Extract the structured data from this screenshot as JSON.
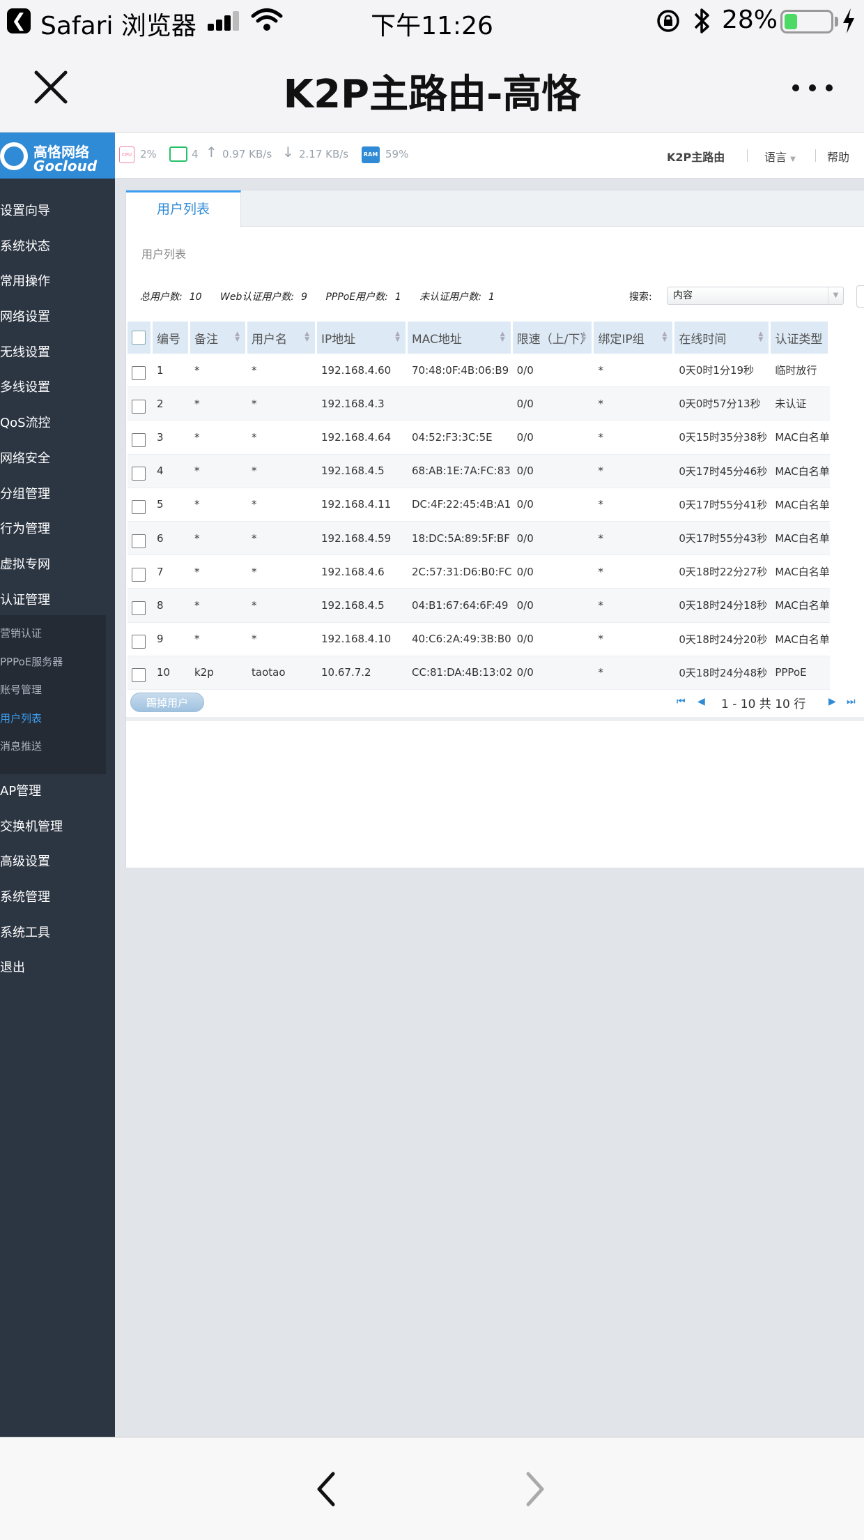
{
  "status_bar": {
    "app_name": "Safari 浏览器",
    "time": "下午11:26",
    "battery_percent": "28%",
    "battery_level": 0.28,
    "icons": [
      "back-app-icon",
      "signal-icon",
      "wifi-icon",
      "orientation-lock-icon",
      "bluetooth-icon",
      "battery-icon",
      "charging-icon"
    ]
  },
  "nav_bar": {
    "title": "K2P主路由-高恪",
    "icons": [
      "close-icon",
      "more-icon"
    ]
  },
  "router": {
    "logo": {
      "cn": "高恪网络",
      "en": "Gocloud"
    },
    "topbar": {
      "cpu_label": "CPU",
      "cpu": "2%",
      "clients": "4",
      "upload": "0.97 KB/s",
      "download": "2.17 KB/s",
      "ram_label": "RAM",
      "ram": "59%",
      "device_name": "K2P主路由",
      "language": "语言",
      "help": "帮助"
    },
    "sidebar": {
      "items_top": [
        "设置向导",
        "系统状态",
        "常用操作",
        "网络设置",
        "无线设置",
        "多线设置",
        "QoS流控",
        "网络安全",
        "分组管理",
        "行为管理",
        "虚拟专网",
        "认证管理"
      ],
      "sub_items": [
        "营销认证",
        "PPPoE服务器",
        "账号管理",
        "用户列表",
        "消息推送"
      ],
      "active_sub": "用户列表",
      "items_bottom": [
        "AP管理",
        "交换机管理",
        "高级设置",
        "系统管理",
        "系统工具",
        "退出"
      ]
    },
    "tab": "用户列表",
    "section_title": "用户列表",
    "stats": {
      "total_label": "总用户数:",
      "total": "10",
      "web_label": "Web认证用户数:",
      "web": "9",
      "pppoe_label": "PPPoE用户数:",
      "pppoe": "1",
      "unauth_label": "未认证用户数:",
      "unauth": "1"
    },
    "search": {
      "label": "搜索:",
      "selected": "内容"
    },
    "table": {
      "columns": [
        "编号",
        "备注",
        "用户名",
        "IP地址",
        "MAC地址",
        "限速（上/下）",
        "绑定IP组",
        "在线时间",
        "认证类型"
      ],
      "rows": [
        [
          "1",
          "*",
          "*",
          "192.168.4.60",
          "70:48:0F:4B:06:B9",
          "0/0",
          "*",
          "0天0时1分19秒",
          "临时放行"
        ],
        [
          "2",
          "*",
          "*",
          "192.168.4.3",
          "",
          "0/0",
          "*",
          "0天0时57分13秒",
          "未认证"
        ],
        [
          "3",
          "*",
          "*",
          "192.168.4.64",
          "04:52:F3:3C:5E",
          "0/0",
          "*",
          "0天15时35分38秒",
          "MAC白名单"
        ],
        [
          "4",
          "*",
          "*",
          "192.168.4.5",
          "68:AB:1E:7A:FC:83",
          "0/0",
          "*",
          "0天17时45分46秒",
          "MAC白名单"
        ],
        [
          "5",
          "*",
          "*",
          "192.168.4.11",
          "DC:4F:22:45:4B:A1",
          "0/0",
          "*",
          "0天17时55分41秒",
          "MAC白名单"
        ],
        [
          "6",
          "*",
          "*",
          "192.168.4.59",
          "18:DC:5A:89:5F:BF",
          "0/0",
          "*",
          "0天17时55分43秒",
          "MAC白名单"
        ],
        [
          "7",
          "*",
          "*",
          "192.168.4.6",
          "2C:57:31:D6:B0:FC",
          "0/0",
          "*",
          "0天18时22分27秒",
          "MAC白名单"
        ],
        [
          "8",
          "*",
          "*",
          "192.168.4.5",
          "04:B1:67:64:6F:49",
          "0/0",
          "*",
          "0天18时24分18秒",
          "MAC白名单"
        ],
        [
          "9",
          "*",
          "*",
          "192.168.4.10",
          "40:C6:2A:49:3B:B0",
          "0/0",
          "*",
          "0天18时24分20秒",
          "MAC白名单"
        ],
        [
          "10",
          "k2p",
          "taotao",
          "10.67.7.2",
          "CC:81:DA:4B:13:02",
          "0/0",
          "*",
          "0天18时24分48秒",
          "PPPoE"
        ]
      ]
    },
    "kick_button": "踢掉用户",
    "pager": "1 - 10 共 10 行",
    "colors": {
      "sidebar": "#2c3542",
      "accent": "#2f8bd6",
      "header_row": "#dde9f5"
    }
  },
  "toolbar": {
    "icons": [
      "back-icon",
      "forward-icon"
    ]
  }
}
